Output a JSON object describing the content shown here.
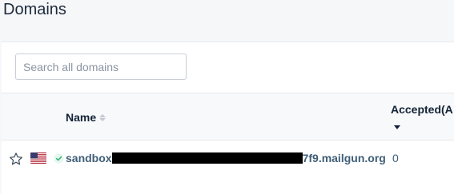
{
  "page": {
    "title": "Domains"
  },
  "search": {
    "placeholder": "Search all domains",
    "value": ""
  },
  "table": {
    "columns": [
      {
        "label": "Name",
        "sort": "none"
      },
      {
        "label": "Accepted(A",
        "sort": "descending"
      }
    ],
    "rows": [
      {
        "starred": false,
        "flag": "us-flag-icon",
        "verified": true,
        "name_prefix": "sandbox",
        "name_suffix": "7f9.mailgun.org",
        "accepted": "0"
      }
    ]
  },
  "colors": {
    "page_background": "#f5f7f9",
    "header_text": "#132235",
    "link_text": "#3f5e78",
    "verified_green": "#2bb673"
  }
}
